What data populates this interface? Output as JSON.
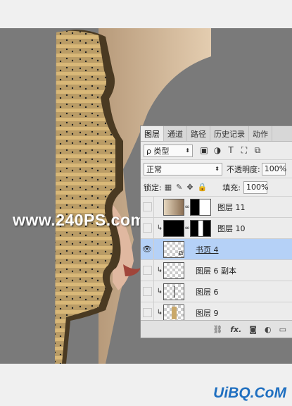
{
  "watermark": "www.240PS.com",
  "logo_text": "UiBQ.CoM",
  "panel": {
    "tabs": [
      "图层",
      "通道",
      "路径",
      "历史记录",
      "动作"
    ],
    "filter_label": "ρ 类型",
    "blend_mode": "正常",
    "opacity_label": "不透明度:",
    "opacity_value": "100%",
    "lock_label": "锁定:",
    "fill_label": "填充:",
    "fill_value": "100%",
    "layers": [
      {
        "name": "图层 11",
        "visible": false,
        "clipped": false,
        "selected": false
      },
      {
        "name": "图层 10",
        "visible": false,
        "clipped": true,
        "selected": false
      },
      {
        "name": "书页 4",
        "visible": true,
        "clipped": false,
        "selected": true
      },
      {
        "name": "图层 6 副本",
        "visible": false,
        "clipped": true,
        "selected": false
      },
      {
        "name": "图层 6",
        "visible": false,
        "clipped": true,
        "selected": false
      },
      {
        "name": "图层 9",
        "visible": false,
        "clipped": true,
        "selected": false
      }
    ],
    "footer_icons": [
      "link-icon",
      "fx-icon",
      "mask-icon",
      "adjustment-icon",
      "group-icon"
    ]
  }
}
